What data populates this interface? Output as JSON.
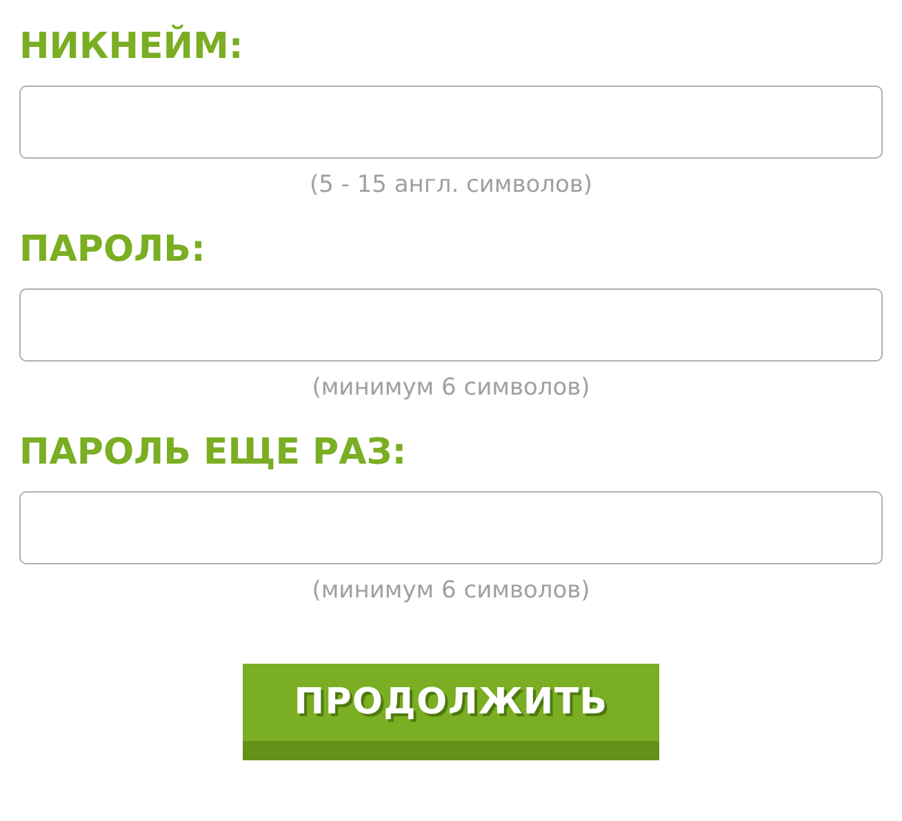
{
  "fields": [
    {
      "label": "НИКНЕЙМ:",
      "hint": "(5 - 15 англ. символов)"
    },
    {
      "label": "ПАРОЛЬ:",
      "hint": "(минимум 6 символов)"
    },
    {
      "label": "ПАРОЛЬ ЕЩЕ РАЗ:",
      "hint": "(минимум 6 символов)"
    }
  ],
  "submit_button": "ПРОДОЛЖИТЬ"
}
